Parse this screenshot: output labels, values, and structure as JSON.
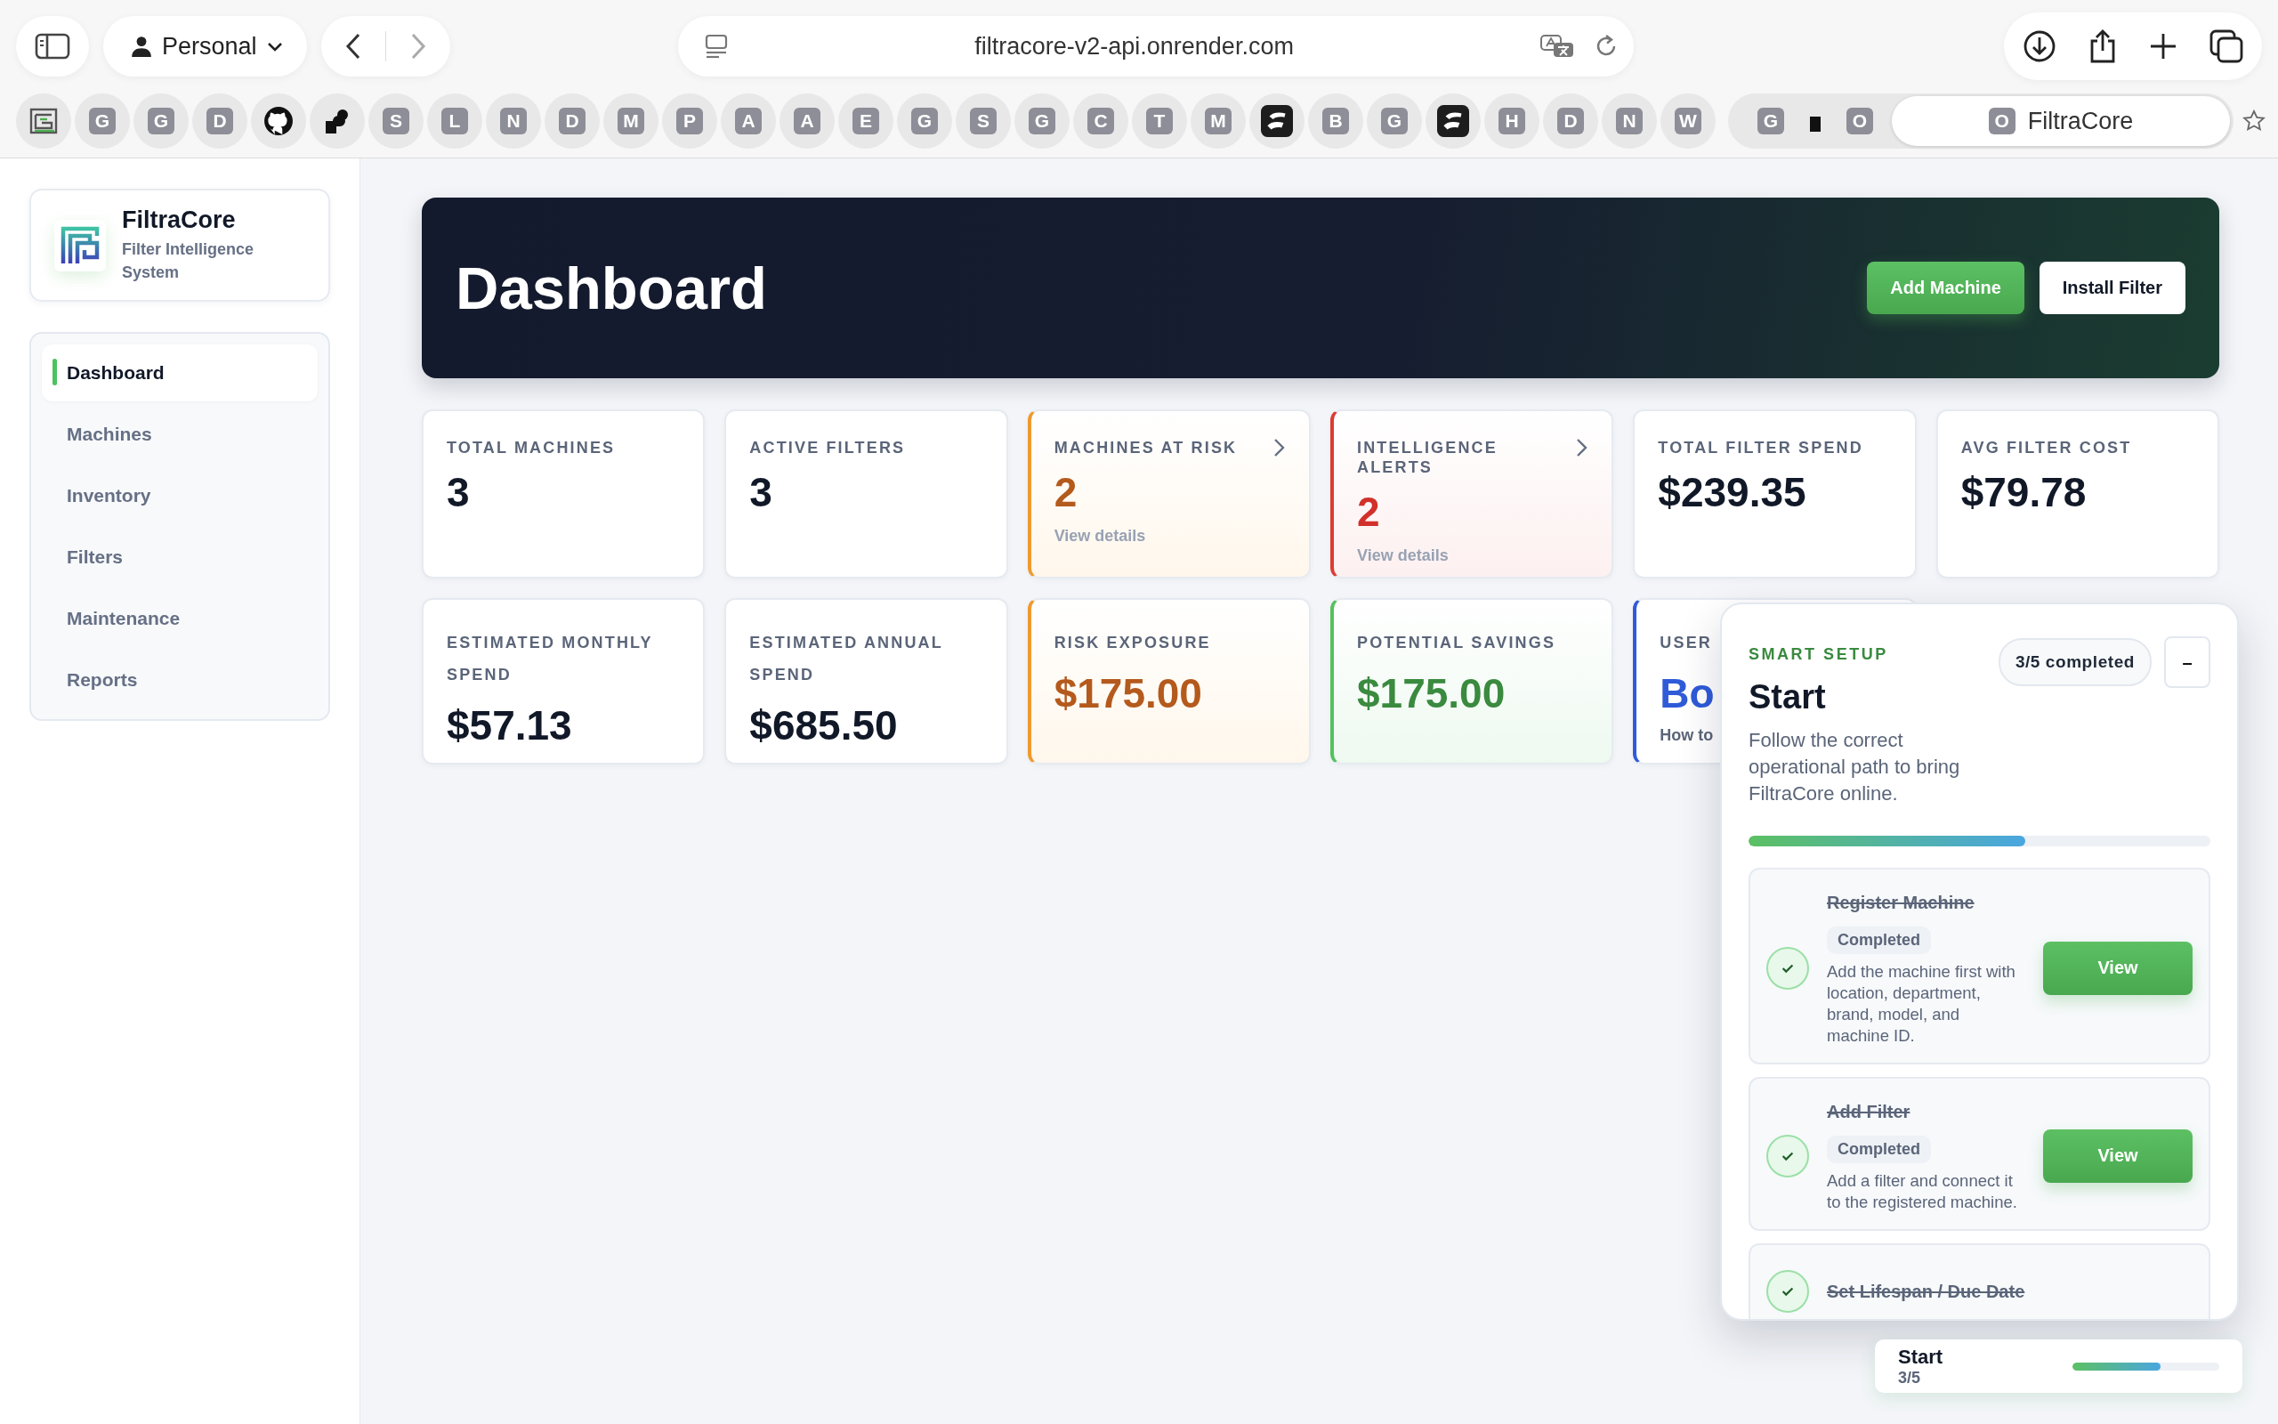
{
  "browser": {
    "profile": "Personal",
    "url": "filtracore-v2-api.onrender.com",
    "bookmarks": [
      {
        "kind": "logo"
      },
      {
        "kind": "letter",
        "label": "G"
      },
      {
        "kind": "letter",
        "label": "G"
      },
      {
        "kind": "letter",
        "label": "D"
      },
      {
        "kind": "github"
      },
      {
        "kind": "blob"
      },
      {
        "kind": "letter",
        "label": "S"
      },
      {
        "kind": "letter",
        "label": "L"
      },
      {
        "kind": "letter",
        "label": "N"
      },
      {
        "kind": "letter",
        "label": "D"
      },
      {
        "kind": "letter",
        "label": "M"
      },
      {
        "kind": "letter",
        "label": "P"
      },
      {
        "kind": "letter",
        "label": "A"
      },
      {
        "kind": "letter",
        "label": "A"
      },
      {
        "kind": "letter",
        "label": "E"
      },
      {
        "kind": "letter",
        "label": "G"
      },
      {
        "kind": "letter",
        "label": "S"
      },
      {
        "kind": "letter",
        "label": "G"
      },
      {
        "kind": "letter",
        "label": "C"
      },
      {
        "kind": "letter",
        "label": "T"
      },
      {
        "kind": "letter",
        "label": "M"
      },
      {
        "kind": "app"
      },
      {
        "kind": "letter",
        "label": "B"
      },
      {
        "kind": "letter",
        "label": "G"
      },
      {
        "kind": "app"
      },
      {
        "kind": "letter",
        "label": "H"
      },
      {
        "kind": "letter",
        "label": "D"
      },
      {
        "kind": "letter",
        "label": "N"
      },
      {
        "kind": "letter",
        "label": "W"
      }
    ],
    "tab_group": [
      {
        "kind": "letter",
        "label": "G"
      },
      {
        "kind": "mark"
      },
      {
        "kind": "letter",
        "label": "O"
      }
    ],
    "active_tab": {
      "icon_letter": "O",
      "title": "FiltraCore",
      "selected": true
    }
  },
  "brand": {
    "name": "FiltraCore",
    "subtitle": "Filter Intelligence System"
  },
  "nav": [
    {
      "label": "Dashboard",
      "selected": true
    },
    {
      "label": "Machines",
      "selected": false
    },
    {
      "label": "Inventory",
      "selected": false
    },
    {
      "label": "Filters",
      "selected": false
    },
    {
      "label": "Maintenance",
      "selected": false
    },
    {
      "label": "Reports",
      "selected": false
    }
  ],
  "header": {
    "title": "Dashboard",
    "buttons": [
      {
        "label": "Add Machine",
        "kind": "primary"
      },
      {
        "label": "Install Filter",
        "kind": "secondary"
      }
    ]
  },
  "stats": [
    {
      "label": "TOTAL MACHINES",
      "value": "3",
      "kind": "neutral"
    },
    {
      "label": "ACTIVE FILTERS",
      "value": "3",
      "kind": "neutral"
    },
    {
      "label": "MACHINES AT RISK",
      "value": "2",
      "kind": "warning",
      "link": "View details"
    },
    {
      "label": "INTELLIGENCE ALERTS",
      "value": "2",
      "kind": "danger",
      "link": "View details"
    },
    {
      "label": "TOTAL FILTER SPEND",
      "value": "$239.35",
      "kind": "neutral"
    },
    {
      "label": "AVG FILTER COST",
      "value": "$79.78",
      "kind": "neutral"
    },
    {
      "label": "ESTIMATED MONTHLY SPEND",
      "value": "$57.13",
      "kind": "neutral"
    },
    {
      "label": "ESTIMATED ANNUAL SPEND",
      "value": "$685.50",
      "kind": "neutral"
    },
    {
      "label": "RISK EXPOSURE",
      "value": "$175.00",
      "kind": "warning"
    },
    {
      "label": "POTENTIAL SAVINGS",
      "value": "$175.00",
      "kind": "success"
    },
    {
      "label": "USER",
      "value": "Bo",
      "kind": "info",
      "note": "How to"
    }
  ],
  "smart_setup": {
    "eyebrow": "SMART SETUP",
    "badge": "3/5 completed",
    "collapse": "–",
    "title": "Start",
    "description": "Follow the correct operational path to bring FiltraCore online.",
    "level": 0.6,
    "steps": [
      {
        "title": "Register Machine",
        "done": true,
        "status": "Completed",
        "description": "Add the machine first with location, department, brand, model, and machine ID.",
        "button": "View"
      },
      {
        "title": "Add Filter",
        "done": true,
        "status": "Completed",
        "description": "Add a filter and connect it to the registered machine.",
        "button": "View"
      },
      {
        "title": "Set Lifespan / Due Date",
        "done": true
      }
    ]
  },
  "mini_progress": {
    "title": "Start",
    "count": "3/5",
    "level": 0.6
  }
}
